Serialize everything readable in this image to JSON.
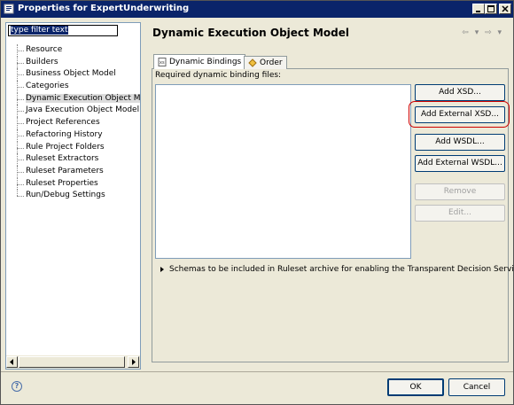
{
  "window": {
    "title": "Properties for ExpertUnderwriting"
  },
  "filter": {
    "value": "type filter text"
  },
  "tree": {
    "items": [
      "Resource",
      "Builders",
      "Business Object Model",
      "Categories",
      "Dynamic Execution Object Model",
      "Java Execution Object Model",
      "Project References",
      "Refactoring History",
      "Rule Project Folders",
      "Ruleset Extractors",
      "Ruleset Parameters",
      "Ruleset Properties",
      "Run/Debug Settings"
    ],
    "selected_index": 4
  },
  "page": {
    "title": "Dynamic Execution Object Model",
    "nav_arrows": "⇦ ▾ ⇨ ▾"
  },
  "tabs": [
    {
      "label": "Dynamic Bindings",
      "icon": "xsd-file-icon",
      "active": true
    },
    {
      "label": "Order",
      "icon": "order-icon",
      "active": false
    }
  ],
  "bindings": {
    "label": "Required dynamic binding files:",
    "buttons": {
      "add_xsd": "Add XSD...",
      "add_external_xsd": "Add External XSD...",
      "add_wsdl": "Add WSDL...",
      "add_external_wsdl": "Add External WSDL...",
      "remove": "Remove",
      "edit": "Edit..."
    },
    "schemas_text": "Schemas to be included in Ruleset archive for enabling the Transparent Decision Service"
  },
  "footer": {
    "ok": "OK",
    "cancel": "Cancel",
    "help_icon": "?"
  },
  "colors": {
    "titlebar": "#0a246a",
    "highlight": "#cc0000"
  }
}
